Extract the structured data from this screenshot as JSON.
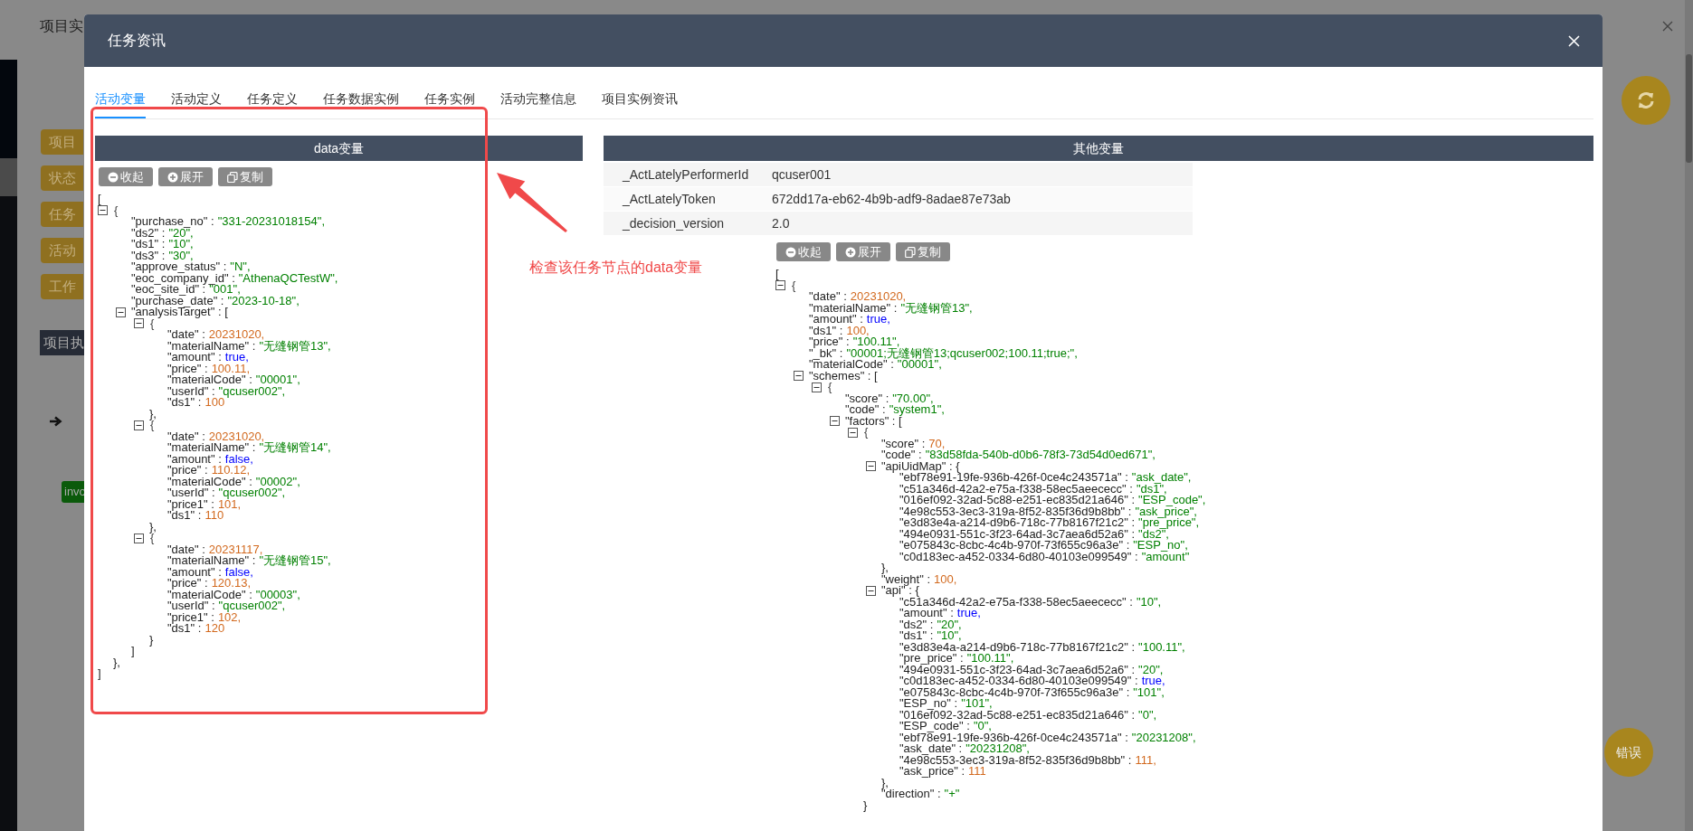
{
  "background": {
    "title": "项目实",
    "buttons": [
      "项目",
      "状态",
      "任务",
      "活动",
      "工作"
    ],
    "section_title": "项目执",
    "badge": "invo",
    "error_button": "错误"
  },
  "modal": {
    "title": "任务资讯"
  },
  "tabs": [
    {
      "label": "活动变量",
      "selected": true
    },
    {
      "label": "活动定义",
      "selected": false
    },
    {
      "label": "任务定义",
      "selected": false
    },
    {
      "label": "任务数据实例",
      "selected": false
    },
    {
      "label": "任务实例",
      "selected": false
    },
    {
      "label": "活动完整信息",
      "selected": false
    },
    {
      "label": "项目实例资讯",
      "selected": false
    }
  ],
  "data_panel": {
    "title": "data变量",
    "buttons": [
      "收起",
      "展开",
      "复制"
    ],
    "json": {
      "open": "[",
      "close": "]",
      "items": [
        {
          "kind": "item",
          "key": "{",
          "expanded": true,
          "close": "},",
          "children": [
            {
              "kind": "string",
              "key": "\"purchase_no\" :",
              "value": "\"331-20231018154\","
            },
            {
              "kind": "string",
              "key": "\"ds2\" :",
              "value": "\"20\","
            },
            {
              "kind": "string",
              "key": "\"ds1\" :",
              "value": "\"10\","
            },
            {
              "kind": "string",
              "key": "\"ds3\" :",
              "value": "\"30\","
            },
            {
              "kind": "string",
              "key": "\"approve_status\" :",
              "value": "\"N\","
            },
            {
              "kind": "string",
              "key": "\"eoc_company_id\" :",
              "value": "\"AthenaQCTestW\","
            },
            {
              "kind": "string",
              "key": "\"eoc_site_id\" :",
              "value": "\"001\","
            },
            {
              "kind": "string",
              "key": "\"purchase_date\" :",
              "value": "\"2023-10-18\","
            },
            {
              "kind": "property",
              "key": "\"analysisTarget\" : [",
              "expanded": true,
              "close": "]",
              "children": [
                {
                  "kind": "item",
                  "key": "{",
                  "expanded": true,
                  "close": "},",
                  "children": [
                    {
                      "kind": "number",
                      "key": "\"date\" :",
                      "value": "20231020,"
                    },
                    {
                      "kind": "string",
                      "key": "\"materialName\" :",
                      "value": "\"无缝钢管13\","
                    },
                    {
                      "kind": "boolean",
                      "key": "\"amount\" :",
                      "value": "true,"
                    },
                    {
                      "kind": "number",
                      "key": "\"price\" :",
                      "value": "100.11,"
                    },
                    {
                      "kind": "string",
                      "key": "\"materialCode\" :",
                      "value": "\"00001\","
                    },
                    {
                      "kind": "string",
                      "key": "\"userId\" :",
                      "value": "\"qcuser002\","
                    },
                    {
                      "kind": "number",
                      "key": "\"ds1\" :",
                      "value": "100"
                    }
                  ]
                },
                {
                  "kind": "item",
                  "key": "{",
                  "expanded": true,
                  "close": "},",
                  "children": [
                    {
                      "kind": "number",
                      "key": "\"date\" :",
                      "value": "20231020,"
                    },
                    {
                      "kind": "string",
                      "key": "\"materialName\" :",
                      "value": "\"无缝钢管14\","
                    },
                    {
                      "kind": "boolean",
                      "key": "\"amount\" :",
                      "value": "false,"
                    },
                    {
                      "kind": "number",
                      "key": "\"price\" :",
                      "value": "110.12,"
                    },
                    {
                      "kind": "string",
                      "key": "\"materialCode\" :",
                      "value": "\"00002\","
                    },
                    {
                      "kind": "string",
                      "key": "\"userId\" :",
                      "value": "\"qcuser002\","
                    },
                    {
                      "kind": "number",
                      "key": "\"price1\" :",
                      "value": "101,"
                    },
                    {
                      "kind": "number",
                      "key": "\"ds1\" :",
                      "value": "110"
                    }
                  ]
                },
                {
                  "kind": "item",
                  "key": "{",
                  "expanded": true,
                  "close": "}",
                  "children": [
                    {
                      "kind": "number",
                      "key": "\"date\" :",
                      "value": "20231117,"
                    },
                    {
                      "kind": "string",
                      "key": "\"materialName\" :",
                      "value": "\"无缝钢管15\","
                    },
                    {
                      "kind": "boolean",
                      "key": "\"amount\" :",
                      "value": "false,"
                    },
                    {
                      "kind": "number",
                      "key": "\"price\" :",
                      "value": "120.13,"
                    },
                    {
                      "kind": "string",
                      "key": "\"materialCode\" :",
                      "value": "\"00003\","
                    },
                    {
                      "kind": "string",
                      "key": "\"userId\" :",
                      "value": "\"qcuser002\","
                    },
                    {
                      "kind": "number",
                      "key": "\"price1\" :",
                      "value": "102,"
                    },
                    {
                      "kind": "number",
                      "key": "\"ds1\" :",
                      "value": "120"
                    }
                  ]
                }
              ]
            }
          ]
        }
      ]
    }
  },
  "other_panel": {
    "title": "其他变量",
    "variables": [
      {
        "name": "_ActLatelyPerformerId",
        "value": "qcuser001"
      },
      {
        "name": "_ActLatelyToken",
        "value": "672dd17a-eb62-4b9b-adf9-8adae87e73ab"
      },
      {
        "name": "_decision_version",
        "value": "2.0"
      }
    ],
    "buttons": [
      "收起",
      "展开",
      "复制"
    ],
    "json": {
      "open": "[",
      "items": [
        {
          "kind": "item",
          "key": "{",
          "expanded": true,
          "children": [
            {
              "kind": "number",
              "key": "\"date\" :",
              "value": "20231020,"
            },
            {
              "kind": "string",
              "key": "\"materialName\" :",
              "value": "\"无缝钢管13\","
            },
            {
              "kind": "boolean",
              "key": "\"amount\" :",
              "value": "true,"
            },
            {
              "kind": "number",
              "key": "\"ds1\" :",
              "value": "100,"
            },
            {
              "kind": "string",
              "key": "\"price\" :",
              "value": "\"100.11\","
            },
            {
              "kind": "string",
              "key": "\"_bk\" :",
              "value": "\"00001;无缝钢管13;qcuser002;100.11;true;\","
            },
            {
              "kind": "string",
              "key": "\"materialCode\" :",
              "value": "\"00001\","
            },
            {
              "kind": "property",
              "key": "\"schemes\" : [",
              "expanded": true,
              "children": [
                {
                  "kind": "item",
                  "key": "{",
                  "expanded": true,
                  "children": [
                    {
                      "kind": "string",
                      "key": "\"score\" :",
                      "value": "\"70.00\","
                    },
                    {
                      "kind": "string",
                      "key": "\"code\" :",
                      "value": "\"system1\","
                    },
                    {
                      "kind": "property",
                      "key": "\"factors\" : [",
                      "expanded": true,
                      "children": [
                        {
                          "kind": "item",
                          "key": "{",
                          "expanded": true,
                          "close": "}",
                          "children": [
                            {
                              "kind": "number",
                              "key": "\"score\" :",
                              "value": "70,"
                            },
                            {
                              "kind": "string",
                              "key": "\"code\" :",
                              "value": "\"83d58fda-540b-d0b6-78f3-73d54d0ed671\","
                            },
                            {
                              "kind": "property",
                              "key": "\"apiUidMap\" : {",
                              "expanded": true,
                              "close": "},",
                              "children": [
                                {
                                  "kind": "string",
                                  "key": "\"ebf78e91-19fe-936b-426f-0ce4c243571a\" :",
                                  "value": "\"ask_date\","
                                },
                                {
                                  "kind": "string",
                                  "key": "\"c51a346d-42a2-e75a-f338-58ec5aeececc\" :",
                                  "value": "\"ds1\","
                                },
                                {
                                  "kind": "string",
                                  "key": "\"016ef092-32ad-5c88-e251-ec835d21a646\" :",
                                  "value": "\"ESP_code\","
                                },
                                {
                                  "kind": "string",
                                  "key": "\"4e98c553-3ec3-319a-8f52-835f36d9b8bb\" :",
                                  "value": "\"ask_price\","
                                },
                                {
                                  "kind": "string",
                                  "key": "\"e3d83e4a-a214-d9b6-718c-77b8167f21c2\" :",
                                  "value": "\"pre_price\","
                                },
                                {
                                  "kind": "string",
                                  "key": "\"494e0931-551c-3f23-64ad-3c7aea6d52a6\" :",
                                  "value": "\"ds2\","
                                },
                                {
                                  "kind": "string",
                                  "key": "\"e075843c-8cbc-4c4b-970f-73f655c96a3e\" :",
                                  "value": "\"ESP_no\","
                                },
                                {
                                  "kind": "string",
                                  "key": "\"c0d183ec-a452-0334-6d80-40103e099549\" :",
                                  "value": "\"amount\""
                                }
                              ]
                            },
                            {
                              "kind": "number",
                              "key": "\"weight\" :",
                              "value": "100,"
                            },
                            {
                              "kind": "property",
                              "key": "\"api\" : {",
                              "expanded": true,
                              "close": "},",
                              "children": [
                                {
                                  "kind": "string",
                                  "key": "\"c51a346d-42a2-e75a-f338-58ec5aeececc\" :",
                                  "value": "\"10\","
                                },
                                {
                                  "kind": "boolean",
                                  "key": "\"amount\" :",
                                  "value": "true,"
                                },
                                {
                                  "kind": "string",
                                  "key": "\"ds2\" :",
                                  "value": "\"20\","
                                },
                                {
                                  "kind": "string",
                                  "key": "\"ds1\" :",
                                  "value": "\"10\","
                                },
                                {
                                  "kind": "string",
                                  "key": "\"e3d83e4a-a214-d9b6-718c-77b8167f21c2\" :",
                                  "value": "\"100.11\","
                                },
                                {
                                  "kind": "string",
                                  "key": "\"pre_price\" :",
                                  "value": "\"100.11\","
                                },
                                {
                                  "kind": "string",
                                  "key": "\"494e0931-551c-3f23-64ad-3c7aea6d52a6\" :",
                                  "value": "\"20\","
                                },
                                {
                                  "kind": "boolean",
                                  "key": "\"c0d183ec-a452-0334-6d80-40103e099549\" :",
                                  "value": "true,"
                                },
                                {
                                  "kind": "string",
                                  "key": "\"e075843c-8cbc-4c4b-970f-73f655c96a3e\" :",
                                  "value": "\"101\","
                                },
                                {
                                  "kind": "string",
                                  "key": "\"ESP_no\" :",
                                  "value": "\"101\","
                                },
                                {
                                  "kind": "string",
                                  "key": "\"016ef092-32ad-5c88-e251-ec835d21a646\" :",
                                  "value": "\"0\","
                                },
                                {
                                  "kind": "string",
                                  "key": "\"ESP_code\" :",
                                  "value": "\"0\","
                                },
                                {
                                  "kind": "string",
                                  "key": "\"ebf78e91-19fe-936b-426f-0ce4c243571a\" :",
                                  "value": "\"20231208\","
                                },
                                {
                                  "kind": "string",
                                  "key": "\"ask_date\" :",
                                  "value": "\"20231208\","
                                },
                                {
                                  "kind": "number",
                                  "key": "\"4e98c553-3ec3-319a-8f52-835f36d9b8bb\" :",
                                  "value": "111,"
                                },
                                {
                                  "kind": "number",
                                  "key": "\"ask_price\" :",
                                  "value": "111"
                                }
                              ]
                            },
                            {
                              "kind": "string",
                              "key": "\"direction\" :",
                              "value": "\"+\""
                            }
                          ]
                        }
                      ]
                    }
                  ]
                }
              ]
            }
          ]
        }
      ]
    }
  },
  "annotation": {
    "text": "检查该任务节点的data变量"
  }
}
